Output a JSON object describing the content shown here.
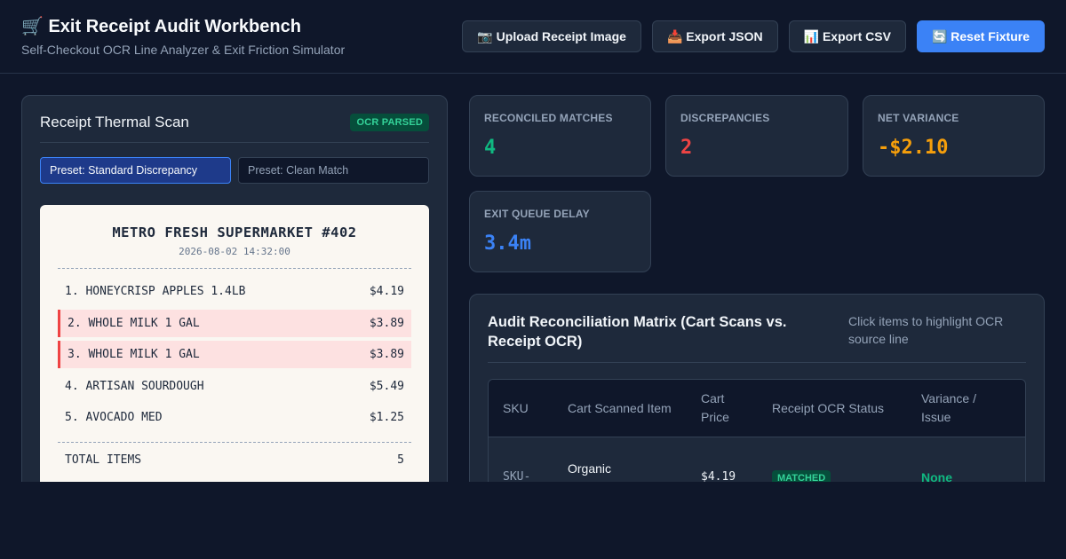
{
  "header": {
    "title": "🛒 Exit Receipt Audit Workbench",
    "subtitle": "Self-Checkout OCR Line Analyzer & Exit Friction Simulator",
    "buttons": {
      "upload": "📷 Upload Receipt Image",
      "export_json": "📥 Export JSON",
      "export_csv": "📊 Export CSV",
      "reset": "🔄 Reset Fixture"
    }
  },
  "receipt_panel": {
    "title": "Receipt Thermal Scan",
    "badge": "OCR PARSED",
    "presets": [
      "Preset: Standard Discrepancy",
      "Preset: Clean Match"
    ],
    "receipt": {
      "store": "METRO FRESH SUPERMARKET #402",
      "datetime": "2026-08-02 14:32:00",
      "lines": [
        {
          "label": "1. HONEYCRISP APPLES 1.4LB",
          "price": "$4.19",
          "flagged": false
        },
        {
          "label": "2. WHOLE MILK 1 GAL",
          "price": "$3.89",
          "flagged": true
        },
        {
          "label": "3. WHOLE MILK 1 GAL",
          "price": "$3.89",
          "flagged": true
        },
        {
          "label": "4. ARTISAN SOURDOUGH",
          "price": "$5.49",
          "flagged": false
        },
        {
          "label": "5. AVOCADO MED",
          "price": "$1.25",
          "flagged": false
        }
      ],
      "total_label": "TOTAL ITEMS",
      "total_value": "5"
    }
  },
  "stats": {
    "reconciled": {
      "label": "RECONCILED MATCHES",
      "value": "4",
      "color": "#10b981"
    },
    "discrepancies": {
      "label": "DISCREPANCIES",
      "value": "2",
      "color": "#ef4444"
    },
    "variance": {
      "label": "NET VARIANCE",
      "value": "-$2.10",
      "color": "#f59e0b"
    },
    "queue": {
      "label": "EXIT QUEUE DELAY",
      "value": "3.4m",
      "color": "#3b82f6"
    }
  },
  "matrix": {
    "title": "Audit Reconciliation Matrix (Cart Scans vs. Receipt OCR)",
    "hint": "Click items to highlight OCR source line",
    "columns": [
      "SKU",
      "Cart Scanned Item",
      "Cart Price",
      "Receipt OCR Status",
      "Variance / Issue"
    ],
    "rows": [
      {
        "sku": "SKU-",
        "item": "Organic Honeycrisp",
        "price": "$4.19",
        "status": "MATCHED",
        "issue": "None"
      }
    ]
  },
  "colors": {
    "accent": "#3b82f6",
    "match": "#10b981",
    "flag": "#ef4444"
  }
}
